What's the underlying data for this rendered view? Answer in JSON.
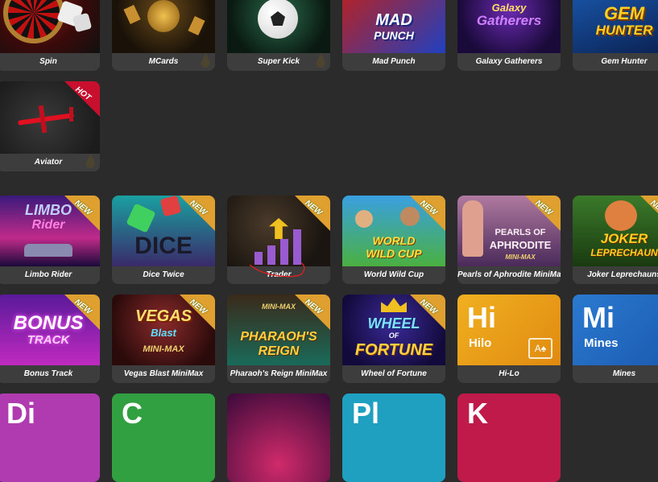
{
  "games": {
    "spin": {
      "title": "Spin"
    },
    "mcards": {
      "title": "MCards"
    },
    "super_kick": {
      "title": "Super Kick"
    },
    "mad_punch": {
      "title": "Mad Punch",
      "art_line1": "MAD",
      "art_line2": "PUNCH"
    },
    "galaxy_gatherers": {
      "title": "Galaxy Gatherers",
      "art_line1": "Galaxy",
      "art_line2": "Gatherers"
    },
    "gem_hunter": {
      "title": "Gem Hunter",
      "art_line1": "GEM",
      "art_line2": "HUNTER"
    },
    "aviator": {
      "title": "Aviator",
      "badge": "HOT"
    },
    "limbo_rider": {
      "title": "Limbo Rider",
      "badge": "NEW",
      "art_line1": "LIMBO",
      "art_line2": "Rider"
    },
    "dice_twice": {
      "title": "Dice Twice",
      "badge": "NEW",
      "art_line1": "DICE"
    },
    "trader": {
      "title": "Trader",
      "badge": "NEW"
    },
    "world_wild_cup": {
      "title": "World Wild Cup",
      "badge": "NEW",
      "art_line1": "WORLD",
      "art_line2": "WILD CUP"
    },
    "pearls_aphrodite": {
      "title": "Pearls of Aphrodite MiniMax",
      "badge": "NEW",
      "art_line1": "PEARLS OF",
      "art_line2": "APHRODITE",
      "art_line3": "MINI-MAX"
    },
    "joker_leprechauns": {
      "title": "Joker Leprechauns",
      "badge": "NEW",
      "art_line1": "JOKER",
      "art_line2": "LEPRECHAUN"
    },
    "bonus_track": {
      "title": "Bonus Track",
      "badge": "NEW",
      "art_line1": "BONUS",
      "art_line2": "TRACK"
    },
    "vegas_blast": {
      "title": "Vegas Blast MiniMax",
      "badge": "NEW",
      "art_line1": "VEGAS",
      "art_line2": "Blast",
      "art_line3": "MINI-MAX"
    },
    "pharaohs_reign": {
      "title": "Pharaoh's Reign MiniMax",
      "badge": "NEW",
      "art_line1": "MINI-MAX",
      "art_line2": "PHARAOH'S",
      "art_line3": "REIGN"
    },
    "wheel_of_fortune": {
      "title": "Wheel of Fortune",
      "badge": "NEW",
      "art_line1": "WHEEL",
      "art_line2": "OF",
      "art_line3": "FORTUNE"
    },
    "hilo": {
      "title": "Hi-Lo",
      "big": "Hi",
      "sub": "Hilo",
      "icon": "A♠"
    },
    "mines": {
      "title": "Mines",
      "big": "Mi",
      "sub": "Mines",
      "icon": "★"
    }
  },
  "partial_row": {
    "letters": [
      "Di",
      "C",
      "",
      "Pl",
      "K"
    ]
  },
  "colors": {
    "background": "#2b2b2b",
    "caption_bg": "#3d3d3d",
    "badge_new": "#e0a030",
    "badge_hot": "#c8102e"
  }
}
